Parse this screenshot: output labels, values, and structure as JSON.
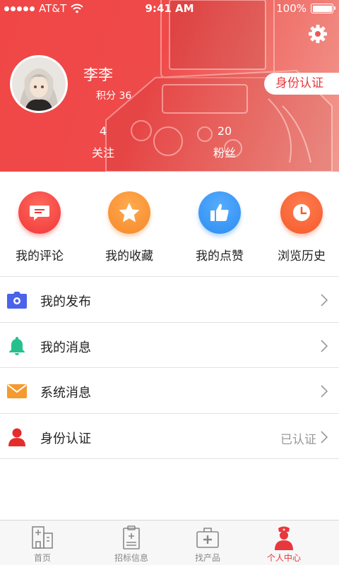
{
  "status_bar": {
    "carrier": "AT&T",
    "time": "9:41 AM",
    "battery_percent": "100%"
  },
  "profile": {
    "username": "李李",
    "points_label": "积分",
    "points_value": "36",
    "verify_button_label": "身份认证",
    "stats": [
      {
        "value": "4",
        "label": "关注"
      },
      {
        "value": "20",
        "label": "粉丝"
      }
    ]
  },
  "quick_actions": [
    {
      "label": "我的评论",
      "icon": "comment-icon",
      "color": "#f0373a"
    },
    {
      "label": "我的收藏",
      "icon": "star-icon",
      "color": "#f7872b"
    },
    {
      "label": "我的点赞",
      "icon": "thumbs-up-icon",
      "color": "#2d8cf0"
    },
    {
      "label": "浏览历史",
      "icon": "clock-icon",
      "color": "#f45a2c"
    }
  ],
  "menu": [
    {
      "label": "我的发布",
      "icon": "camera-icon",
      "color": "#4a63e8",
      "status": ""
    },
    {
      "label": "我的消息",
      "icon": "bell-icon",
      "color": "#25c08d",
      "status": ""
    },
    {
      "label": "系统消息",
      "icon": "envelope-icon",
      "color": "#f59a2f",
      "status": ""
    },
    {
      "label": "身份认证",
      "icon": "person-icon",
      "color": "#e62b2b",
      "status": "已认证"
    }
  ],
  "tab_bar": {
    "active": 3,
    "tabs": [
      {
        "label": "首页",
        "icon": "hospital-building-icon"
      },
      {
        "label": "招标信息",
        "icon": "clipboard-icon"
      },
      {
        "label": "找产品",
        "icon": "medical-kit-icon"
      },
      {
        "label": "个人中心",
        "icon": "nurse-icon"
      }
    ]
  },
  "colors": {
    "header_red": "#f04646",
    "accent": "#e8383d"
  }
}
